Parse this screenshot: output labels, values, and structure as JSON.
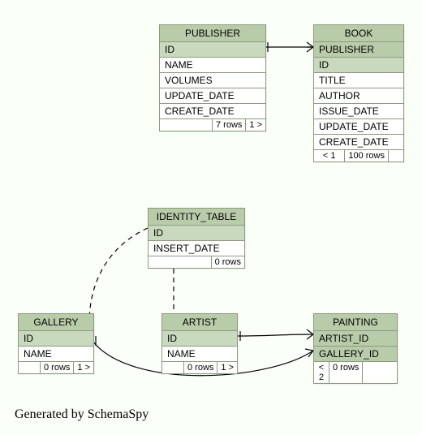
{
  "generated_by": "Generated by SchemaSpy",
  "entities": {
    "publisher": {
      "title": "PUBLISHER",
      "cols": [
        "ID",
        "NAME",
        "VOLUMES",
        "UPDATE_DATE",
        "CREATE_DATE"
      ],
      "pk_cols": [
        "ID"
      ],
      "footer_left": "",
      "footer_mid": "7 rows",
      "footer_right": "1 >"
    },
    "book": {
      "title": "BOOK",
      "fk_cols": [
        "PUBLISHER"
      ],
      "pk_cols": [
        "ID"
      ],
      "cols": [
        "TITLE",
        "AUTHOR",
        "ISSUE_DATE",
        "UPDATE_DATE",
        "CREATE_DATE"
      ],
      "footer_left": "< 1",
      "footer_mid": "100 rows",
      "footer_right": ""
    },
    "identity_table": {
      "title": "IDENTITY_TABLE",
      "pk_cols": [
        "ID"
      ],
      "cols": [
        "INSERT_DATE"
      ],
      "footer_left": "",
      "footer_mid": "0 rows"
    },
    "gallery": {
      "title": "GALLERY",
      "pk_cols": [
        "ID"
      ],
      "cols": [
        "NAME"
      ],
      "footer_left": "",
      "footer_mid": "0 rows",
      "footer_right": "1 >"
    },
    "artist": {
      "title": "ARTIST",
      "pk_cols": [
        "ID"
      ],
      "cols": [
        "NAME"
      ],
      "footer_left": "",
      "footer_mid": "0 rows",
      "footer_right": "1 >"
    },
    "painting": {
      "title": "PAINTING",
      "fk_cols": [
        "ARTIST_ID",
        "GALLERY_ID"
      ],
      "footer_left": "< 2",
      "footer_mid": "0 rows",
      "footer_right": ""
    }
  }
}
